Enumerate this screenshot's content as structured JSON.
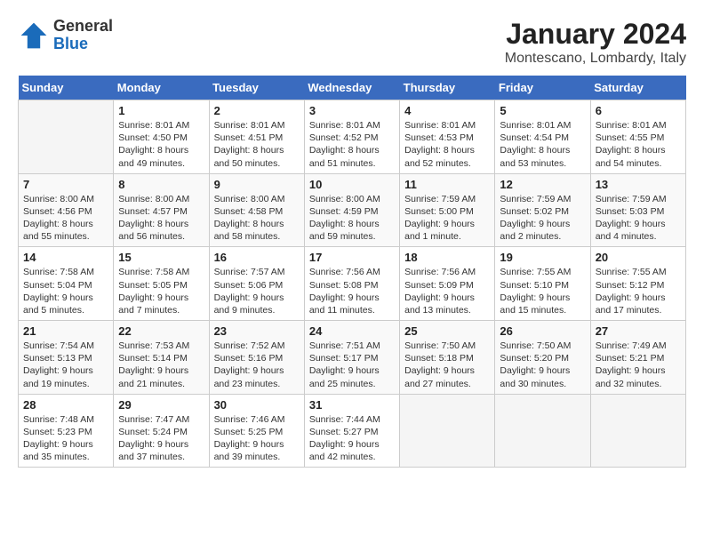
{
  "header": {
    "logo_general": "General",
    "logo_blue": "Blue",
    "month_title": "January 2024",
    "location": "Montescano, Lombardy, Italy"
  },
  "days_of_week": [
    "Sunday",
    "Monday",
    "Tuesday",
    "Wednesday",
    "Thursday",
    "Friday",
    "Saturday"
  ],
  "weeks": [
    [
      {
        "day": "",
        "info": ""
      },
      {
        "day": "1",
        "info": "Sunrise: 8:01 AM\nSunset: 4:50 PM\nDaylight: 8 hours\nand 49 minutes."
      },
      {
        "day": "2",
        "info": "Sunrise: 8:01 AM\nSunset: 4:51 PM\nDaylight: 8 hours\nand 50 minutes."
      },
      {
        "day": "3",
        "info": "Sunrise: 8:01 AM\nSunset: 4:52 PM\nDaylight: 8 hours\nand 51 minutes."
      },
      {
        "day": "4",
        "info": "Sunrise: 8:01 AM\nSunset: 4:53 PM\nDaylight: 8 hours\nand 52 minutes."
      },
      {
        "day": "5",
        "info": "Sunrise: 8:01 AM\nSunset: 4:54 PM\nDaylight: 8 hours\nand 53 minutes."
      },
      {
        "day": "6",
        "info": "Sunrise: 8:01 AM\nSunset: 4:55 PM\nDaylight: 8 hours\nand 54 minutes."
      }
    ],
    [
      {
        "day": "7",
        "info": "Sunrise: 8:00 AM\nSunset: 4:56 PM\nDaylight: 8 hours\nand 55 minutes."
      },
      {
        "day": "8",
        "info": "Sunrise: 8:00 AM\nSunset: 4:57 PM\nDaylight: 8 hours\nand 56 minutes."
      },
      {
        "day": "9",
        "info": "Sunrise: 8:00 AM\nSunset: 4:58 PM\nDaylight: 8 hours\nand 58 minutes."
      },
      {
        "day": "10",
        "info": "Sunrise: 8:00 AM\nSunset: 4:59 PM\nDaylight: 8 hours\nand 59 minutes."
      },
      {
        "day": "11",
        "info": "Sunrise: 7:59 AM\nSunset: 5:00 PM\nDaylight: 9 hours\nand 1 minute."
      },
      {
        "day": "12",
        "info": "Sunrise: 7:59 AM\nSunset: 5:02 PM\nDaylight: 9 hours\nand 2 minutes."
      },
      {
        "day": "13",
        "info": "Sunrise: 7:59 AM\nSunset: 5:03 PM\nDaylight: 9 hours\nand 4 minutes."
      }
    ],
    [
      {
        "day": "14",
        "info": "Sunrise: 7:58 AM\nSunset: 5:04 PM\nDaylight: 9 hours\nand 5 minutes."
      },
      {
        "day": "15",
        "info": "Sunrise: 7:58 AM\nSunset: 5:05 PM\nDaylight: 9 hours\nand 7 minutes."
      },
      {
        "day": "16",
        "info": "Sunrise: 7:57 AM\nSunset: 5:06 PM\nDaylight: 9 hours\nand 9 minutes."
      },
      {
        "day": "17",
        "info": "Sunrise: 7:56 AM\nSunset: 5:08 PM\nDaylight: 9 hours\nand 11 minutes."
      },
      {
        "day": "18",
        "info": "Sunrise: 7:56 AM\nSunset: 5:09 PM\nDaylight: 9 hours\nand 13 minutes."
      },
      {
        "day": "19",
        "info": "Sunrise: 7:55 AM\nSunset: 5:10 PM\nDaylight: 9 hours\nand 15 minutes."
      },
      {
        "day": "20",
        "info": "Sunrise: 7:55 AM\nSunset: 5:12 PM\nDaylight: 9 hours\nand 17 minutes."
      }
    ],
    [
      {
        "day": "21",
        "info": "Sunrise: 7:54 AM\nSunset: 5:13 PM\nDaylight: 9 hours\nand 19 minutes."
      },
      {
        "day": "22",
        "info": "Sunrise: 7:53 AM\nSunset: 5:14 PM\nDaylight: 9 hours\nand 21 minutes."
      },
      {
        "day": "23",
        "info": "Sunrise: 7:52 AM\nSunset: 5:16 PM\nDaylight: 9 hours\nand 23 minutes."
      },
      {
        "day": "24",
        "info": "Sunrise: 7:51 AM\nSunset: 5:17 PM\nDaylight: 9 hours\nand 25 minutes."
      },
      {
        "day": "25",
        "info": "Sunrise: 7:50 AM\nSunset: 5:18 PM\nDaylight: 9 hours\nand 27 minutes."
      },
      {
        "day": "26",
        "info": "Sunrise: 7:50 AM\nSunset: 5:20 PM\nDaylight: 9 hours\nand 30 minutes."
      },
      {
        "day": "27",
        "info": "Sunrise: 7:49 AM\nSunset: 5:21 PM\nDaylight: 9 hours\nand 32 minutes."
      }
    ],
    [
      {
        "day": "28",
        "info": "Sunrise: 7:48 AM\nSunset: 5:23 PM\nDaylight: 9 hours\nand 35 minutes."
      },
      {
        "day": "29",
        "info": "Sunrise: 7:47 AM\nSunset: 5:24 PM\nDaylight: 9 hours\nand 37 minutes."
      },
      {
        "day": "30",
        "info": "Sunrise: 7:46 AM\nSunset: 5:25 PM\nDaylight: 9 hours\nand 39 minutes."
      },
      {
        "day": "31",
        "info": "Sunrise: 7:44 AM\nSunset: 5:27 PM\nDaylight: 9 hours\nand 42 minutes."
      },
      {
        "day": "",
        "info": ""
      },
      {
        "day": "",
        "info": ""
      },
      {
        "day": "",
        "info": ""
      }
    ]
  ]
}
